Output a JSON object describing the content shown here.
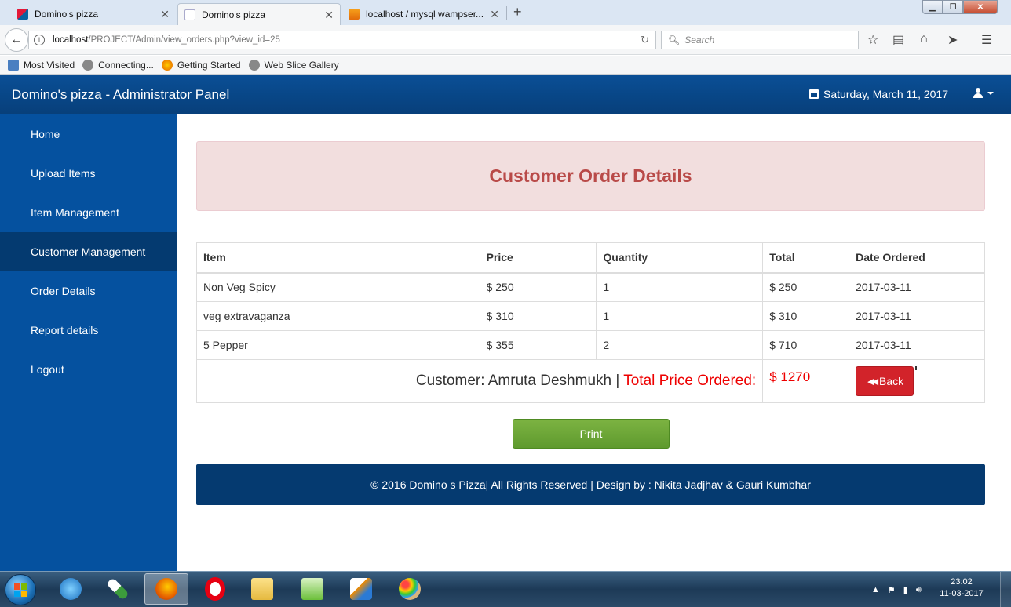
{
  "browser": {
    "tabs": [
      {
        "title": "Domino's pizza",
        "state": "inactive"
      },
      {
        "title": "Domino's pizza",
        "state": "active"
      },
      {
        "title": "localhost / mysql wampser...",
        "state": "inactive"
      }
    ],
    "url_host": "localhost",
    "url_path": "/PROJECT/Admin/view_orders.php?view_id=25",
    "search_placeholder": "Search",
    "bookmarks": [
      "Most Visited",
      "Connecting...",
      "Getting Started",
      "Web Slice Gallery"
    ]
  },
  "app": {
    "title": "Domino's pizza - Administrator Panel",
    "date": "Saturday, March 11, 2017"
  },
  "sidebar": {
    "items": [
      {
        "label": "Home"
      },
      {
        "label": "Upload Items"
      },
      {
        "label": "Item Management"
      },
      {
        "label": "Customer Management",
        "active": true
      },
      {
        "label": "Order Details"
      },
      {
        "label": "Report details"
      },
      {
        "label": "Logout"
      }
    ]
  },
  "main": {
    "heading": "Customer Order Details",
    "columns": [
      "Item",
      "Price",
      "Quantity",
      "Total",
      "Date Ordered"
    ],
    "rows": [
      {
        "item": "Non Veg Spicy",
        "price": "$ 250",
        "qty": "1",
        "total": "$ 250",
        "date": "2017-03-11"
      },
      {
        "item": "veg extravaganza",
        "price": "$ 310",
        "qty": "1",
        "total": "$ 310",
        "date": "2017-03-11"
      },
      {
        "item": "5 Pepper",
        "price": "$ 355",
        "qty": "2",
        "total": "$ 710",
        "date": "2017-03-11"
      }
    ],
    "customer_text": "Customer: Amruta Deshmukh |",
    "total_label": "Total Price Ordered:",
    "grand_total": "$ 1270",
    "back_label": "Back",
    "print_label": "Print",
    "footer": "© 2016 Domino s Pizza| All Rights Reserved | Design by : Nikita Jadjhav & Gauri Kumbhar"
  },
  "taskbar": {
    "time": "23:02",
    "date": "11-03-2017"
  },
  "colors": {
    "header_blue": "#0a4f96",
    "sidebar_blue": "#05519f",
    "sidebar_active": "#043a70",
    "alert_bg": "#f2dede",
    "alert_text": "#b94a48",
    "total_red": "#ee0000",
    "back_red": "#d2232a",
    "print_green": "#6ea639",
    "footer_navy": "#053a70"
  }
}
